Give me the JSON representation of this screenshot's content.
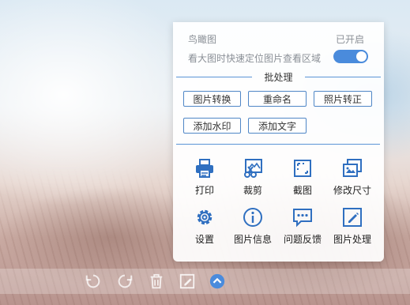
{
  "panel": {
    "bird_view_label": "鸟瞰图",
    "bird_view_status": "已开启",
    "bird_view_desc": "看大图时快速定位图片查看区域",
    "bird_view_enabled": true,
    "batch_title": "批处理",
    "batch_buttons": [
      "图片转换",
      "重命名",
      "照片转正",
      "添加水印",
      "添加文字"
    ],
    "tools": [
      {
        "label": "打印",
        "icon": "printer-icon"
      },
      {
        "label": "裁剪",
        "icon": "crop-icon"
      },
      {
        "label": "截图",
        "icon": "screenshot-icon"
      },
      {
        "label": "修改尺寸",
        "icon": "resize-icon"
      },
      {
        "label": "设置",
        "icon": "gear-icon"
      },
      {
        "label": "图片信息",
        "icon": "info-icon"
      },
      {
        "label": "问题反馈",
        "icon": "feedback-icon"
      },
      {
        "label": "图片处理",
        "icon": "edit-icon"
      }
    ]
  },
  "bottom_bar": {
    "buttons": [
      "rotate-left-icon",
      "rotate-right-icon",
      "delete-icon",
      "edit-icon",
      "more-icon"
    ]
  },
  "colors": {
    "accent": "#4a8bdc",
    "icon_blue": "#2f6fc0"
  }
}
